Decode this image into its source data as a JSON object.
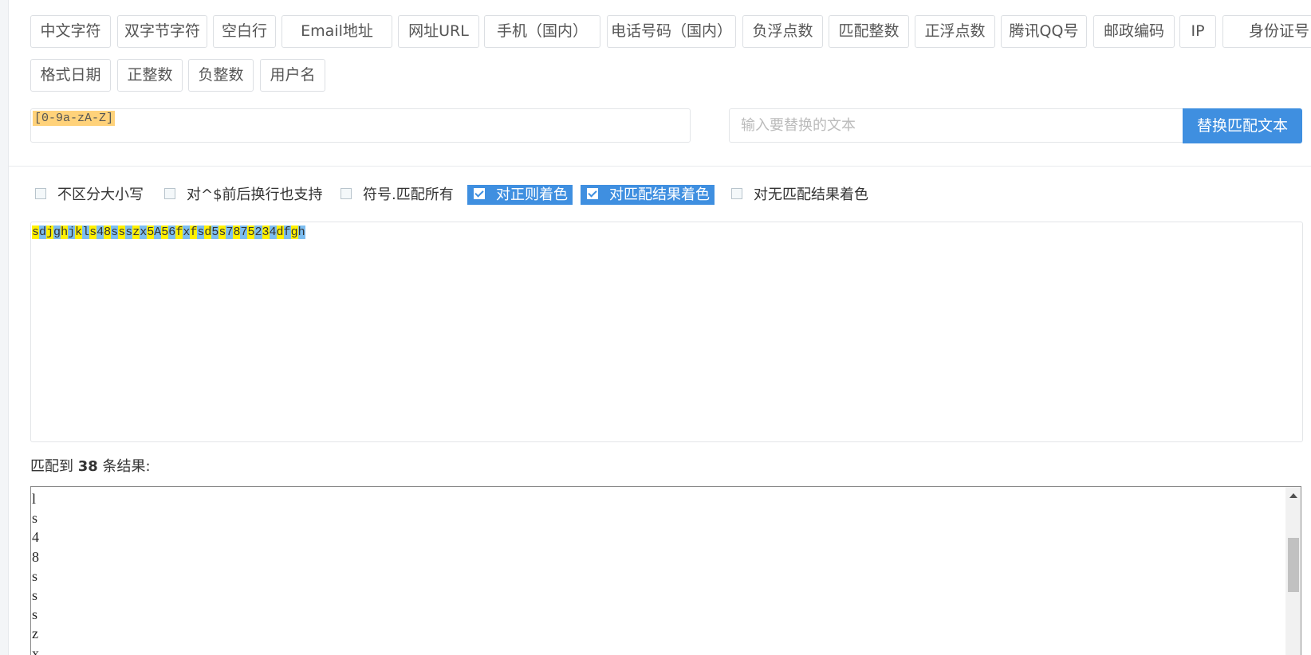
{
  "presets": [
    "中文字符",
    "双字节字符",
    "空白行",
    "Email地址",
    "网址URL",
    "手机（国内）",
    "电话号码（国内）",
    "负浮点数",
    "匹配整数",
    "正浮点数",
    "腾讯QQ号",
    "邮政编码",
    "IP",
    "身份证号",
    "格式日期",
    "正整数",
    "负整数",
    "用户名"
  ],
  "regex": {
    "value": "[0-9a-zA-Z]"
  },
  "replace": {
    "placeholder": "输入要替换的文本",
    "button": "替换匹配文本"
  },
  "options": [
    {
      "label": "不区分大小写",
      "checked": false
    },
    {
      "label": "对^$前后换行也支持",
      "checked": false
    },
    {
      "label": "符号.匹配所有",
      "checked": false
    },
    {
      "label": "对正则着色",
      "checked": true
    },
    {
      "label": "对匹配结果着色",
      "checked": true
    },
    {
      "label": "对无匹配结果着色",
      "checked": false
    }
  ],
  "test_text": "sdjghjkls48ssszx5A56fxfsd5s7875234dfgh",
  "result": {
    "prefix": "匹配到",
    "count": "38",
    "suffix": "条结果:"
  },
  "results_visible": [
    "l",
    "s",
    "4",
    "8",
    "s",
    "s",
    "s",
    "z",
    "x"
  ],
  "colors": {
    "accent": "#3f8fe0",
    "match_yellow": "#fff000",
    "match_blue": "#7cbdf0",
    "regex_highlight": "#ffd27a"
  }
}
